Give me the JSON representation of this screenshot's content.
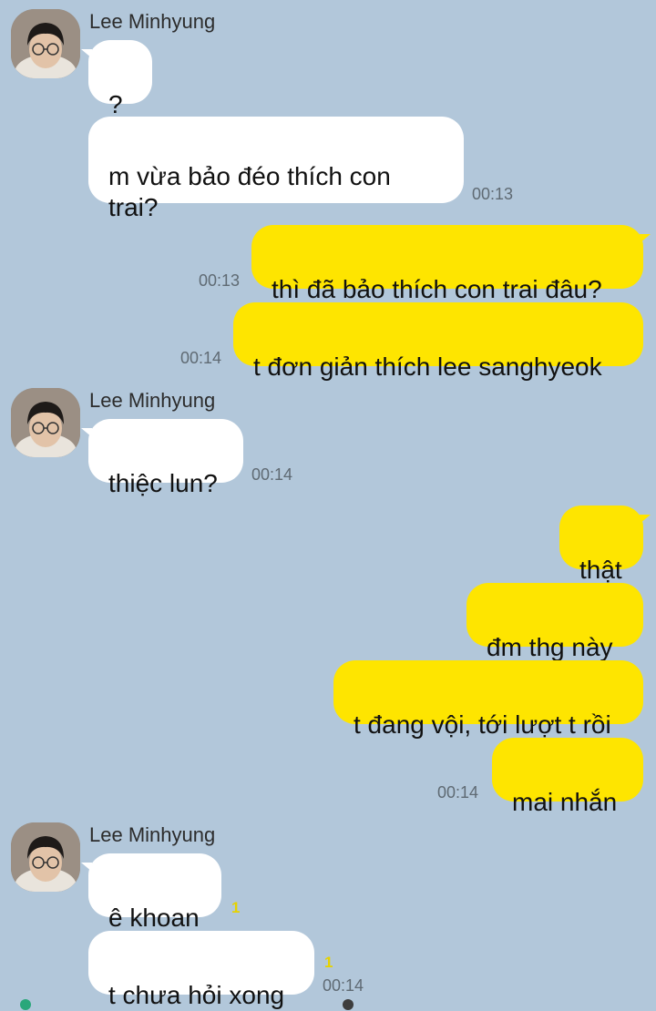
{
  "contact": {
    "name": "Lee Minhyung"
  },
  "messages": [
    {
      "from": "them",
      "text": "?",
      "time": ""
    },
    {
      "from": "them",
      "text": "m vừa bảo đéo thích con trai?",
      "time": "00:13"
    },
    {
      "from": "me",
      "text": "thì đã bảo thích con trai đâu?",
      "time": "00:13"
    },
    {
      "from": "me",
      "text": "t đơn giản thích lee sanghyeok",
      "time": "00:14"
    },
    {
      "from": "them",
      "text": "thiệc lun?",
      "time": "00:14"
    },
    {
      "from": "me",
      "text": "thật",
      "time": ""
    },
    {
      "from": "me",
      "text": "đm thg này",
      "time": ""
    },
    {
      "from": "me",
      "text": "t đang vội, tới lượt t rồi",
      "time": ""
    },
    {
      "from": "me",
      "text": "mai nhắn",
      "time": "00:14"
    },
    {
      "from": "them",
      "text": "ê khoan",
      "time": "",
      "unread": "1"
    },
    {
      "from": "them",
      "text": "t chưa hỏi xong",
      "time": "00:14",
      "unread": "1"
    }
  ],
  "colors": {
    "background": "#b2c7da",
    "incoming_bubble": "#ffffff",
    "outgoing_bubble": "#fee500",
    "unread_count": "#e6d200"
  },
  "icons": {
    "avatar": "profile-photo"
  }
}
